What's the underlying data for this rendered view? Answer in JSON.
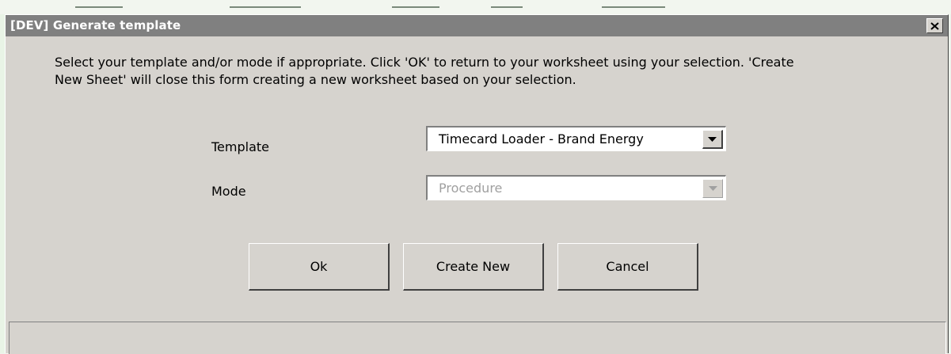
{
  "window": {
    "title": "[DEV] Generate template",
    "close_icon": "close-icon"
  },
  "instructions": {
    "line1": "Select your template and/or mode if appropriate. Click 'OK' to return to your worksheet using your selection.  'Create",
    "line2": "New Sheet' will close this form creating a new worksheet based on your selection."
  },
  "form": {
    "template": {
      "label": "Template",
      "value": "Timecard Loader - Brand Energy",
      "enabled": true
    },
    "mode": {
      "label": "Mode",
      "value": "Procedure",
      "enabled": false
    }
  },
  "buttons": {
    "ok": "Ok",
    "create_new": "Create New",
    "cancel": "Cancel"
  },
  "colors": {
    "dialog_face": "#d6d3ce",
    "titlebar_inactive": "#808080",
    "disabled_text": "#a0a0a0"
  }
}
